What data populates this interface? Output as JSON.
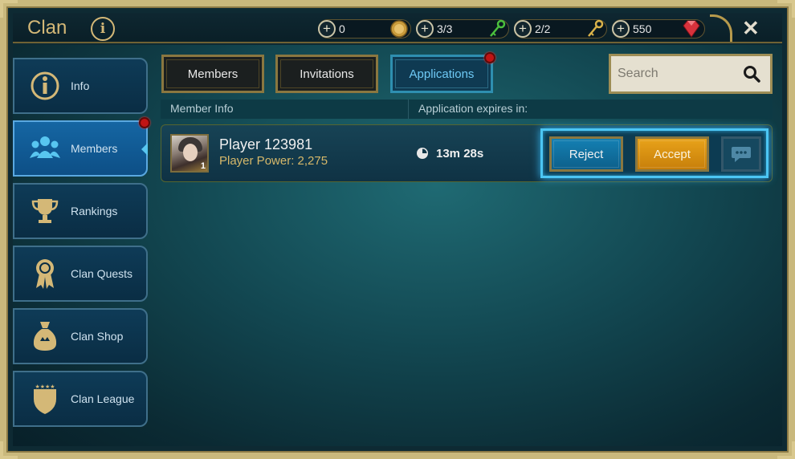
{
  "header": {
    "title": "Clan",
    "info_glyph": "i",
    "resources": [
      {
        "value": "0",
        "icon": "gold-coin-icon",
        "color": "#d8b454"
      },
      {
        "value": "3/3",
        "icon": "green-key-icon",
        "color": "#4bbf3d"
      },
      {
        "value": "2/2",
        "icon": "gold-key-icon",
        "color": "#d9b24a"
      },
      {
        "value": "550",
        "icon": "ruby-gem-icon",
        "color": "#d8323c"
      }
    ],
    "close_glyph": "✕"
  },
  "sidebar": {
    "items": [
      {
        "label": "Info",
        "icon": "info-icon",
        "active": false
      },
      {
        "label": "Members",
        "icon": "members-icon",
        "active": true,
        "notification": true
      },
      {
        "label": "Rankings",
        "icon": "trophy-icon",
        "active": false
      },
      {
        "label": "Clan Quests",
        "icon": "medal-icon",
        "active": false
      },
      {
        "label": "Clan Shop",
        "icon": "money-bag-icon",
        "active": false
      },
      {
        "label": "Clan League",
        "icon": "shield-icon",
        "active": false
      }
    ]
  },
  "tabs": [
    {
      "label": "Members",
      "active": false
    },
    {
      "label": "Invitations",
      "active": false
    },
    {
      "label": "Applications",
      "active": true,
      "notification": true
    }
  ],
  "search": {
    "placeholder": "Search"
  },
  "table": {
    "headers": [
      "Member Info",
      "Application expires in:"
    ],
    "rows": [
      {
        "player_name": "Player 123981",
        "player_power": "Player Power: 2,275",
        "avatar_level": "1",
        "expires": "13m 28s",
        "actions": {
          "reject": "Reject",
          "accept": "Accept"
        }
      }
    ]
  },
  "colors": {
    "accent_gold": "#d4b877",
    "active_blue": "#1566a3",
    "highlight_cyan": "#4cc6f4",
    "notification_red": "#c01414"
  }
}
